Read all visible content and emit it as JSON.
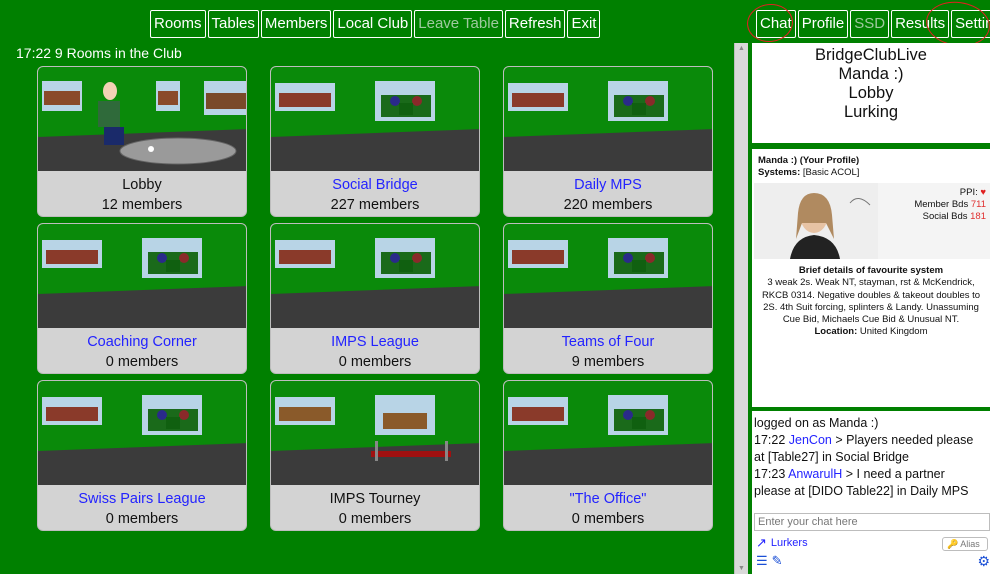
{
  "topbar": {
    "left_buttons": [
      {
        "label": "Rooms",
        "disabled": false
      },
      {
        "label": "Tables",
        "disabled": false
      },
      {
        "label": "Members",
        "disabled": false
      },
      {
        "label": "Local Club",
        "disabled": false
      },
      {
        "label": "Leave Table",
        "disabled": true
      },
      {
        "label": "Refresh",
        "disabled": false
      },
      {
        "label": "Exit",
        "disabled": false
      }
    ],
    "right_buttons": [
      {
        "label": "Chat",
        "disabled": false
      },
      {
        "label": "Profile",
        "disabled": false
      },
      {
        "label": "SSD",
        "disabled": true
      },
      {
        "label": "Results",
        "disabled": false
      },
      {
        "label": "Settings",
        "disabled": false
      }
    ]
  },
  "rooms_header": "17:22 9 Rooms in the Club",
  "rooms": [
    {
      "name": "Lobby",
      "members": "12 members",
      "link": false
    },
    {
      "name": "Social Bridge",
      "members": "227 members",
      "link": true
    },
    {
      "name": "Daily MPS",
      "members": "220 members",
      "link": true
    },
    {
      "name": "Coaching Corner",
      "members": "0 members",
      "link": true
    },
    {
      "name": "IMPS League",
      "members": "0 members",
      "link": true
    },
    {
      "name": "Teams of Four",
      "members": "9 members",
      "link": true
    },
    {
      "name": "Swiss Pairs League",
      "members": "0 members",
      "link": true
    },
    {
      "name": "IMPS Tourney",
      "members": "0 members",
      "link": false
    },
    {
      "name": "\"The Office\"",
      "members": "0 members",
      "link": true
    }
  ],
  "side": {
    "app_name": "BridgeClubLive",
    "user": "Manda :)",
    "location": "Lobby",
    "status": "Lurking"
  },
  "profile": {
    "title": "Manda :) (Your Profile)",
    "systems_label": "Systems:",
    "systems_value": "[Basic ACOL]",
    "ppi_label": "PPI:",
    "member_bds_label": "Member Bds",
    "member_bds_value": "711",
    "social_bds_label": "Social Bds",
    "social_bds_value": "181",
    "brief_heading": "Brief details of favourite system",
    "brief_text": "3 weak 2s. Weak NT, stayman, rst & McKendrick, RKCB 0314. Negative doubles & takeout doubles to 2S. 4th Suit forcing, splinters & Landy. Unassuming Cue Bid, Michaels Cue Bid & Unusual NT.",
    "location_label": "Location:",
    "location_value": "United Kingdom"
  },
  "chat": {
    "logged_on": "logged on as Manda :)",
    "messages": [
      {
        "time": "17:22",
        "who": "JenCon",
        "text": "> Players needed please at [Table27] in Social Bridge"
      },
      {
        "time": "17:23",
        "who": "AnwarulH",
        "text": "> I need a partner please at [DIDO Table22] in Daily MPS"
      }
    ],
    "input_placeholder": "Enter your chat here",
    "lurkers_label": "Lurkers",
    "alias_label": "Alias"
  },
  "colors": {
    "green_bg": "#008000",
    "link_blue": "#2323ff",
    "annotation_red": "#e02020"
  }
}
